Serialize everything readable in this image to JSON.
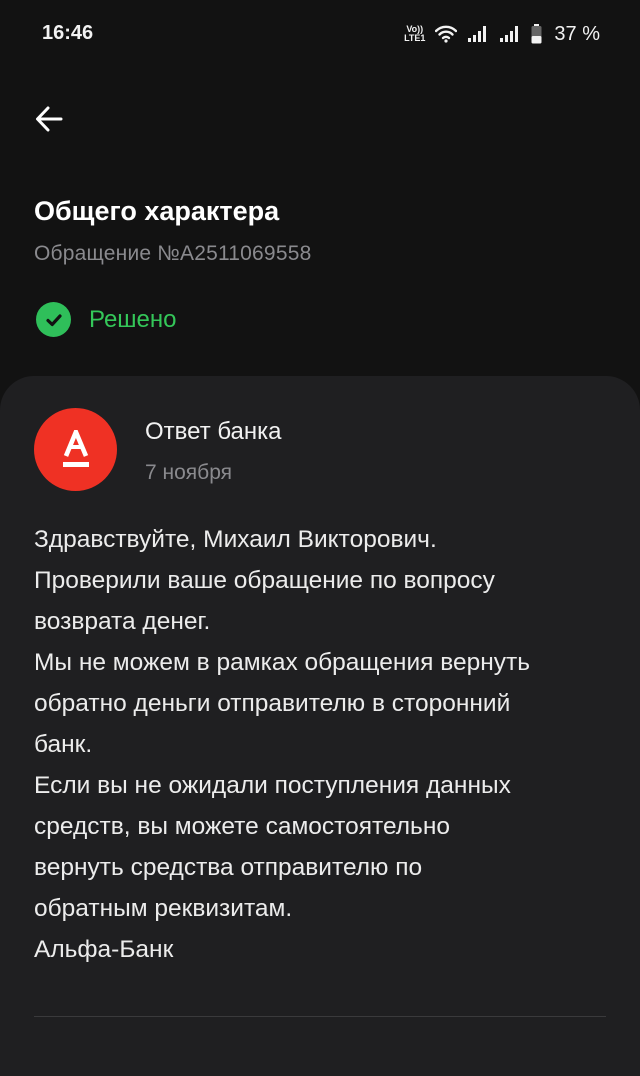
{
  "status_bar": {
    "time": "16:46",
    "volte_top": "Vo))",
    "volte_bottom": "LTE1",
    "battery": "37 %"
  },
  "header": {
    "title": "Общего характера",
    "request_number": "Обращение №A2511069558",
    "status": "Решено",
    "status_color": "#34c759"
  },
  "message": {
    "sender": "Ответ банка",
    "date": "7 ноября",
    "logo_color": "#ef3124",
    "lines": [
      "Здравствуйте, Михаил Викторович.",
      "Проверили ваше обращение по вопросу",
      "возврата денег.",
      "Мы не можем в рамках обращения вернуть",
      "обратно деньги отправителю в сторонний",
      "банк.",
      "Если вы не ожидали поступления данных",
      "средств, вы можете самостоятельно",
      "вернуть средства отправителю по",
      "обратным реквизитам.",
      "Альфа-Банк"
    ]
  }
}
